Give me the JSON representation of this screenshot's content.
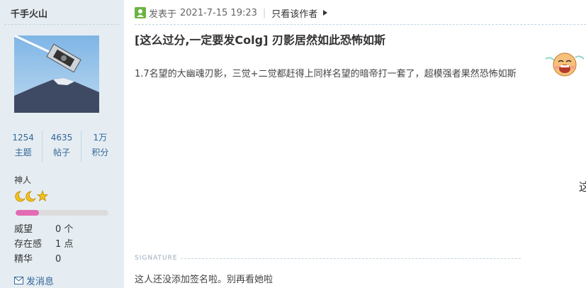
{
  "user": {
    "name": "千手火山",
    "stats": [
      {
        "value": "1254",
        "label": "主题"
      },
      {
        "value": "4635",
        "label": "帖子"
      },
      {
        "value": "1万",
        "label": "积分"
      }
    ],
    "grade": "神人",
    "progress": 0.25,
    "profile": [
      {
        "key": "威望",
        "value": "0 个"
      },
      {
        "key": "存在感",
        "value": "1 点"
      },
      {
        "key": "精华",
        "value": "0"
      }
    ],
    "pm_label": "发消息"
  },
  "post": {
    "posted_prefix": "发表于",
    "posted_time": "2021-7-15 19:23",
    "author_only_label": "只看该作者",
    "title": "[这么过分,一定要发Colg] 刃影居然如此恐怖如斯",
    "content": "1.7名望的大幽魂刃影，三觉+二觉都赶得上同样名望的暗帝打一套了，超模强者果然恐怖如斯",
    "edge_char": "这",
    "signature_label": "SIGNATURE",
    "signature_text": "这人还没添加签名啦。别再看她啦"
  },
  "colors": {
    "sidebar": "#e5edf2",
    "link": "#336699",
    "progress": "#e36bb4"
  },
  "icons": [
    "online-status-icon",
    "star-icon",
    "moon-icon",
    "mail-icon",
    "triangle-right-icon",
    "laughing-emoji-icon"
  ]
}
